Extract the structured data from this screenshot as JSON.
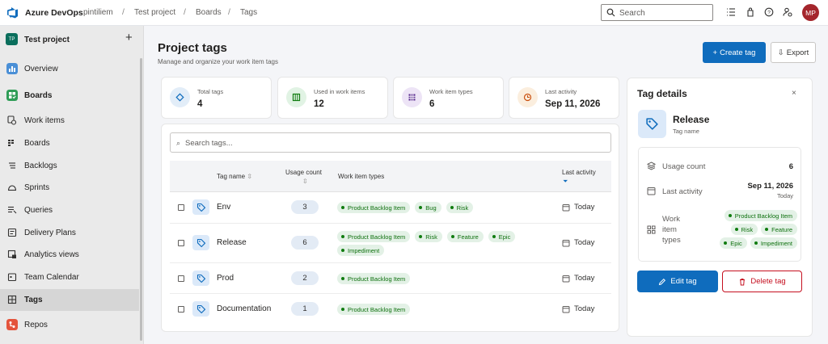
{
  "topbar": {
    "brand": "Azure DevOps",
    "breadcrumbs": [
      "pintiliem",
      "Test project",
      "Boards",
      "Tags"
    ],
    "separator": "/",
    "search_placeholder": "Search",
    "avatar_initials": "MP"
  },
  "sidebar": {
    "project_badge": "TP",
    "project_name": "Test project",
    "add_label": "+",
    "items": [
      {
        "label": "Overview"
      },
      {
        "label": "Boards"
      },
      {
        "label": "Work items"
      },
      {
        "label": "Boards"
      },
      {
        "label": "Backlogs"
      },
      {
        "label": "Sprints"
      },
      {
        "label": "Queries"
      },
      {
        "label": "Delivery Plans"
      },
      {
        "label": "Analytics views"
      },
      {
        "label": "Team Calendar"
      },
      {
        "label": "Tags"
      },
      {
        "label": "Repos"
      }
    ]
  },
  "page": {
    "title": "Project tags",
    "subtitle": "Manage and organize your work item tags",
    "create_label": "Create tag",
    "create_icon": "+",
    "export_label": "Export",
    "export_icon": "⇩"
  },
  "stats": [
    {
      "label": "Total tags",
      "value": "4",
      "color": "#0f6cbd"
    },
    {
      "label": "Used in work items",
      "value": "12",
      "color": "#107c10"
    },
    {
      "label": "Work item types",
      "value": "6",
      "color": "#5c2e91"
    },
    {
      "label": "Last activity",
      "value": "Sep 11, 2026",
      "color": "#ca5010"
    }
  ],
  "table": {
    "search_placeholder": "Search tags...",
    "search_icon": "⌕",
    "headers": {
      "name": "Tag name",
      "count": "Usage count",
      "types": "Work item types",
      "last": "Last activity"
    },
    "rows": [
      {
        "name": "Env",
        "count": "3",
        "types": [
          "Product Backlog Item",
          "Bug",
          "Risk"
        ],
        "last": "Today"
      },
      {
        "name": "Release",
        "count": "6",
        "types": [
          "Product Backlog Item",
          "Risk",
          "Feature",
          "Epic",
          "Impediment"
        ],
        "last": "Today"
      },
      {
        "name": "Prod",
        "count": "2",
        "types": [
          "Product Backlog Item"
        ],
        "last": "Today"
      },
      {
        "name": "Documentation",
        "count": "1",
        "types": [
          "Product Backlog Item"
        ],
        "last": "Today"
      }
    ]
  },
  "details": {
    "title": "Tag details",
    "close": "×",
    "tag_name": "Release",
    "tag_sub": "Tag name",
    "usage_label": "Usage count",
    "usage_value": "6",
    "last_label": "Last activity",
    "last_value": "Sep 11, 2026",
    "last_sub": "Today",
    "types_label": [
      "Work",
      "item",
      "types"
    ],
    "types": [
      "Product Backlog Item",
      "Risk",
      "Feature",
      "Epic",
      "Impediment"
    ],
    "edit_label": "Edit tag",
    "delete_label": "Delete tag"
  }
}
